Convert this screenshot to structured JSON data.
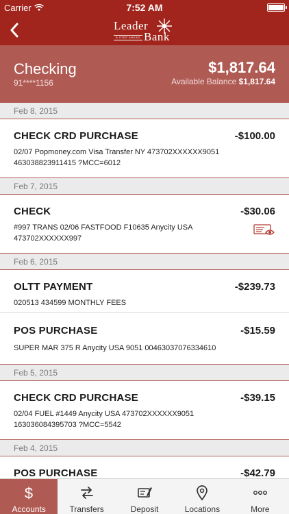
{
  "status_bar": {
    "carrier": "Carrier",
    "time": "7:52 AM"
  },
  "header": {
    "logo_line1": "Leader",
    "logo_line2": "Bank",
    "logo_tagline": "A STEP AHEAD"
  },
  "account": {
    "name": "Checking",
    "number": "91****1156",
    "balance": "$1,817.64",
    "available_label": "Available Balance",
    "available_balance": "$1,817.64"
  },
  "transactions": [
    {
      "date": "Feb 8, 2015",
      "items": [
        {
          "title": "CHECK CRD PURCHASE",
          "amount": "-$100.00",
          "desc1": "02/07 Popmoney.com Visa Transfer NY 473702XXXXXX9051",
          "desc2": "463038823911415 ?MCC=6012"
        }
      ]
    },
    {
      "date": "Feb 7, 2015",
      "items": [
        {
          "title": "CHECK",
          "amount": "-$30.06",
          "desc1": "#997 TRANS 02/06 FASTFOOD F10635 Anycity USA",
          "desc2": "473702XXXXXX997",
          "icon": "check-image-icon"
        }
      ]
    },
    {
      "date": "Feb 6, 2015",
      "items": [
        {
          "title": "OLTT PAYMENT",
          "amount": "-$239.73",
          "desc1": "020513 434599 MONTHLY FEES"
        },
        {
          "title": "POS PURCHASE",
          "amount": "-$15.59",
          "desc1": "SUPER MAR 375 R Anycity USA 9051 00463037076334610"
        }
      ]
    },
    {
      "date": "Feb 5, 2015",
      "items": [
        {
          "title": "CHECK CRD PURCHASE",
          "amount": "-$39.15",
          "desc1": "02/04 FUEL #1449 Anycity USA 473702XXXXXX9051",
          "desc2": "163036084395703 ?MCC=5542"
        }
      ]
    },
    {
      "date": "Feb 4, 2015",
      "items": [
        {
          "title": "POS PURCHASE",
          "amount": "-$42.79"
        }
      ]
    }
  ],
  "tabs": [
    {
      "label": "Accounts",
      "icon": "dollar-icon",
      "active": true
    },
    {
      "label": "Transfers",
      "icon": "transfer-arrows-icon"
    },
    {
      "label": "Deposit",
      "icon": "check-deposit-icon"
    },
    {
      "label": "Locations",
      "icon": "location-pin-icon"
    },
    {
      "label": "More",
      "icon": "more-dots-icon"
    }
  ],
  "colors": {
    "brand": "#a1251c",
    "header_band": "#b05a54",
    "accent_icon": "#b23a2f"
  }
}
